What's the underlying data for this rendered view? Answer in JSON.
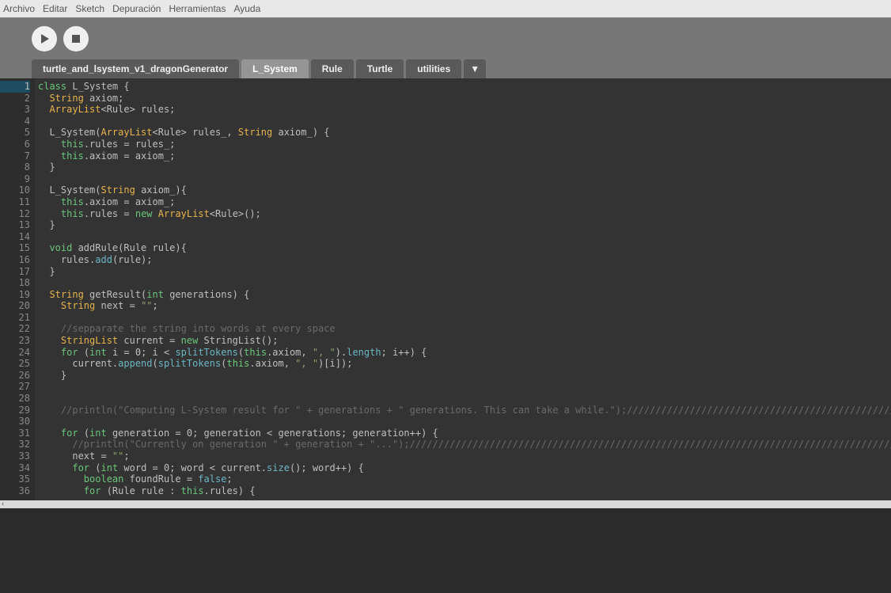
{
  "menu": [
    "Archivo",
    "Editar",
    "Sketch",
    "Depuración",
    "Herramientas",
    "Ayuda"
  ],
  "tabs": [
    {
      "label": "turtle_and_lsystem_v1_dragonGenerator",
      "active": false
    },
    {
      "label": "L_System",
      "active": true
    },
    {
      "label": "Rule",
      "active": false
    },
    {
      "label": "Turtle",
      "active": false
    },
    {
      "label": "utilities",
      "active": false
    }
  ],
  "tab_menu_glyph": "▼",
  "chevron_glyph": "‹",
  "line_count": 36,
  "highlight_line": 1,
  "code": [
    [
      [
        "kw-class",
        "class"
      ],
      [
        "id",
        " L_System {"
      ]
    ],
    [
      [
        "id",
        "  "
      ],
      [
        "kw-type",
        "String"
      ],
      [
        "id",
        " axiom;"
      ]
    ],
    [
      [
        "id",
        "  "
      ],
      [
        "kw-type",
        "ArrayList"
      ],
      [
        "id",
        "<Rule> rules;"
      ]
    ],
    [],
    [
      [
        "id",
        "  L_System("
      ],
      [
        "kw-type",
        "ArrayList"
      ],
      [
        "id",
        "<Rule> rules_, "
      ],
      [
        "kw-type",
        "String"
      ],
      [
        "id",
        " axiom_) {"
      ]
    ],
    [
      [
        "id",
        "    "
      ],
      [
        "kw-this",
        "this"
      ],
      [
        "id",
        ".rules = rules_;"
      ]
    ],
    [
      [
        "id",
        "    "
      ],
      [
        "kw-this",
        "this"
      ],
      [
        "id",
        ".axiom = axiom_;"
      ]
    ],
    [
      [
        "id",
        "  }"
      ]
    ],
    [],
    [
      [
        "id",
        "  L_System("
      ],
      [
        "kw-type",
        "String"
      ],
      [
        "id",
        " axiom_){"
      ]
    ],
    [
      [
        "id",
        "    "
      ],
      [
        "kw-this",
        "this"
      ],
      [
        "id",
        ".axiom = axiom_;"
      ]
    ],
    [
      [
        "id",
        "    "
      ],
      [
        "kw-this",
        "this"
      ],
      [
        "id",
        ".rules = "
      ],
      [
        "kw-new",
        "new"
      ],
      [
        "id",
        " "
      ],
      [
        "kw-type",
        "ArrayList"
      ],
      [
        "id",
        "<Rule>();"
      ]
    ],
    [
      [
        "id",
        "  }"
      ]
    ],
    [],
    [
      [
        "id",
        "  "
      ],
      [
        "kw-flow",
        "void"
      ],
      [
        "id",
        " addRule(Rule rule){"
      ]
    ],
    [
      [
        "id",
        "    rules."
      ],
      [
        "fn",
        "add"
      ],
      [
        "id",
        "(rule);"
      ]
    ],
    [
      [
        "id",
        "  }"
      ]
    ],
    [],
    [
      [
        "id",
        "  "
      ],
      [
        "kw-type",
        "String"
      ],
      [
        "id",
        " getResult("
      ],
      [
        "kw-flow",
        "int"
      ],
      [
        "id",
        " generations) {"
      ]
    ],
    [
      [
        "id",
        "    "
      ],
      [
        "kw-type",
        "String"
      ],
      [
        "id",
        " next = "
      ],
      [
        "str",
        "\"\""
      ],
      [
        "id",
        ";"
      ]
    ],
    [],
    [
      [
        "id",
        "    "
      ],
      [
        "cmt",
        "//sepparate the string into words at every space"
      ]
    ],
    [
      [
        "id",
        "    "
      ],
      [
        "kw-type",
        "StringList"
      ],
      [
        "id",
        " current = "
      ],
      [
        "kw-new",
        "new"
      ],
      [
        "id",
        " StringList();"
      ]
    ],
    [
      [
        "id",
        "    "
      ],
      [
        "kw-flow",
        "for"
      ],
      [
        "id",
        " ("
      ],
      [
        "kw-flow",
        "int"
      ],
      [
        "id",
        " i = 0; i < "
      ],
      [
        "fn",
        "splitTokens"
      ],
      [
        "id",
        "("
      ],
      [
        "kw-this",
        "this"
      ],
      [
        "id",
        ".axiom, "
      ],
      [
        "str",
        "\", \""
      ],
      [
        "id",
        ")."
      ],
      [
        "fn",
        "length"
      ],
      [
        "id",
        "; i++) {"
      ]
    ],
    [
      [
        "id",
        "      current."
      ],
      [
        "fn",
        "append"
      ],
      [
        "id",
        "("
      ],
      [
        "fn",
        "splitTokens"
      ],
      [
        "id",
        "("
      ],
      [
        "kw-this",
        "this"
      ],
      [
        "id",
        ".axiom, "
      ],
      [
        "str",
        "\", \""
      ],
      [
        "id",
        ")[i]);"
      ]
    ],
    [
      [
        "id",
        "    }"
      ]
    ],
    [],
    [],
    [
      [
        "id",
        "    "
      ],
      [
        "cmt",
        "//println(\"Computing L-System result for \" + generations + \" generations. This can take a while.\");////////////////////////////////////////////////////"
      ]
    ],
    [],
    [
      [
        "id",
        "    "
      ],
      [
        "kw-flow",
        "for"
      ],
      [
        "id",
        " ("
      ],
      [
        "kw-flow",
        "int"
      ],
      [
        "id",
        " generation = 0; generation < generations; generation++) {"
      ]
    ],
    [
      [
        "id",
        "      "
      ],
      [
        "cmt",
        "//println(\"Currently on generation \" + generation + \"...\");/////////////////////////////////////////////////////////////////////////////////////////////////"
      ]
    ],
    [
      [
        "id",
        "      next = "
      ],
      [
        "str",
        "\"\""
      ],
      [
        "id",
        ";"
      ]
    ],
    [
      [
        "id",
        "      "
      ],
      [
        "kw-flow",
        "for"
      ],
      [
        "id",
        " ("
      ],
      [
        "kw-flow",
        "int"
      ],
      [
        "id",
        " word = 0; word < current."
      ],
      [
        "fn",
        "size"
      ],
      [
        "id",
        "(); word++) {"
      ]
    ],
    [
      [
        "id",
        "        "
      ],
      [
        "kw-flow",
        "boolean"
      ],
      [
        "id",
        " foundRule = "
      ],
      [
        "kw-bool",
        "false"
      ],
      [
        "id",
        ";"
      ]
    ],
    [
      [
        "id",
        "        "
      ],
      [
        "kw-flow",
        "for"
      ],
      [
        "id",
        " (Rule rule : "
      ],
      [
        "kw-this",
        "this"
      ],
      [
        "id",
        ".rules) {"
      ]
    ]
  ]
}
